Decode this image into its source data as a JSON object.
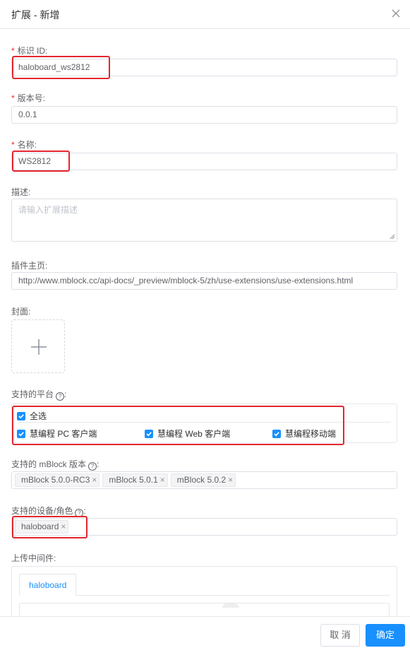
{
  "dialog": {
    "title": "扩展 - 新增"
  },
  "form": {
    "id": {
      "label": "标识 ID:",
      "value": "haloboard_ws2812"
    },
    "version": {
      "label": "版本号:",
      "value": "0.0.1"
    },
    "name": {
      "label": "名称:",
      "value": "WS2812"
    },
    "description": {
      "label": "描述:",
      "placeholder": "请输入扩展描述"
    },
    "homepage": {
      "label": "插件主页:",
      "value": "http://www.mblock.cc/api-docs/_preview/mblock-5/zh/use-extensions/use-extensions.html"
    },
    "cover": {
      "label": "封面:"
    },
    "platforms": {
      "label": "支持的平台",
      "select_all": "全选",
      "options": [
        "慧编程 PC 客户端",
        "慧编程 Web 客户端",
        "慧编程移动端"
      ]
    },
    "mblock_versions": {
      "label": "支持的 mBlock 版本",
      "tags": [
        "mBlock 5.0.0-RC3",
        "mBlock 5.0.1",
        "mBlock 5.0.2"
      ]
    },
    "devices": {
      "label": "支持的设备/角色",
      "tags": [
        "haloboard"
      ]
    },
    "middleware": {
      "label": "上传中间件:",
      "tab": "haloboard"
    }
  },
  "footer": {
    "cancel": "取 消",
    "confirm": "确定"
  },
  "colors": {
    "primary": "#1890ff",
    "highlight": "#e5262d",
    "required": "#f5222d"
  }
}
